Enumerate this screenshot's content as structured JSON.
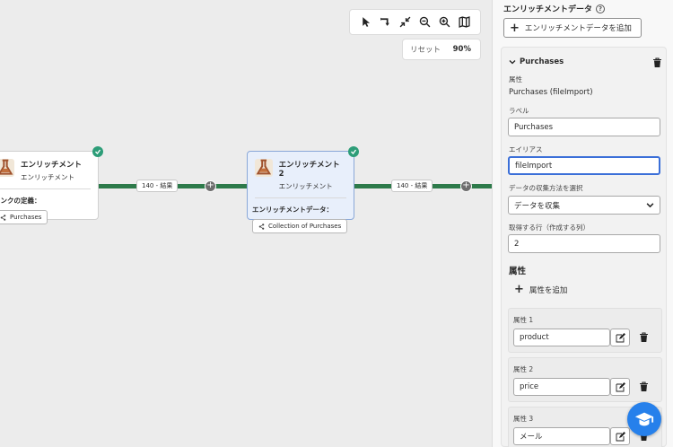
{
  "canvas": {
    "toolbar": {
      "icons": [
        "pointer-icon",
        "rewire-icon",
        "collapse-icon",
        "zoom-out-icon",
        "zoom-in-icon",
        "map-icon"
      ]
    },
    "zoom": {
      "reset_label": "リセット",
      "value": "90%"
    },
    "nodes": [
      {
        "title": "エンリッチメント",
        "subtitle": "エンリッチメント",
        "field_label": "リンクの定義：",
        "chip": "Purchases"
      },
      {
        "title": "エンリッチメント 2",
        "subtitle": "エンリッチメント",
        "field_label": "エンリッチメントデータ：",
        "chip": "Collection of Purchases"
      }
    ],
    "edges": [
      {
        "label": "140 - 結果"
      },
      {
        "label": "140 - 結果"
      }
    ],
    "colors": {
      "edge": "#2d7a4a",
      "check": "#2d9d78",
      "selected_bg": "#e8effb"
    }
  },
  "panel": {
    "title": "エンリッチメントデータ",
    "add_button": "エンリッチメントデータを追加",
    "card": {
      "title": "Purchases",
      "attribute_label": "属性",
      "attribute_value": "Purchases (fileImport)",
      "label_label": "ラベル",
      "label_value": "Purchases",
      "alias_label": "エイリアス",
      "alias_value": "fileImport",
      "collect_label": "データの収集方法を選択",
      "collect_value": "データを収集",
      "rows_label": "取得する行（作成する列）",
      "rows_value": "2",
      "attributes_heading": "属性",
      "add_attribute": "属性を追加",
      "attributes": [
        {
          "label": "属性 1",
          "value": "product"
        },
        {
          "label": "属性 2",
          "value": "price"
        },
        {
          "label": "属性 3",
          "value": "メール"
        }
      ]
    },
    "colors": {
      "focus": "#3b6fd8",
      "fab": "#2680eb"
    }
  }
}
